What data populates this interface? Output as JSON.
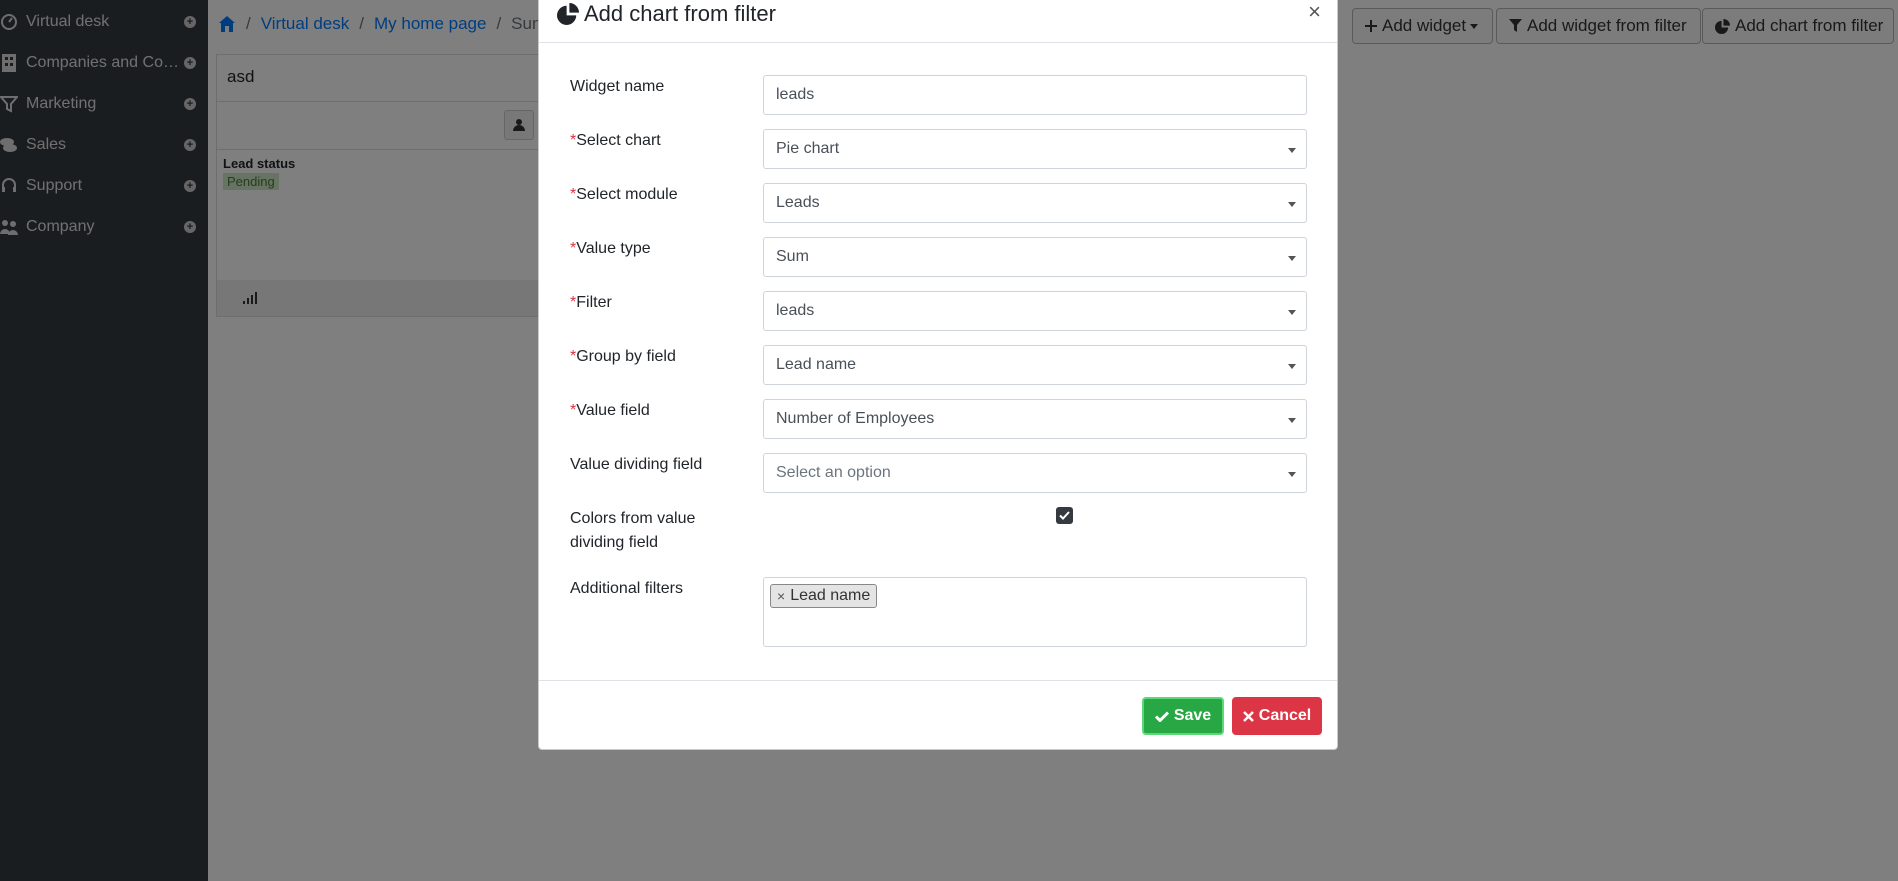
{
  "sidebar": {
    "items": [
      {
        "label": "Virtual desk",
        "icon": "speedometer-icon"
      },
      {
        "label": "Companies and Con...",
        "icon": "building-icon"
      },
      {
        "label": "Marketing",
        "icon": "funnel-icon"
      },
      {
        "label": "Sales",
        "icon": "coins-icon"
      },
      {
        "label": "Support",
        "icon": "headset-icon"
      },
      {
        "label": "Company",
        "icon": "users-icon"
      }
    ]
  },
  "breadcrumb": {
    "home_icon": "home-icon",
    "items": [
      "Virtual desk",
      "My home page",
      "Summa"
    ]
  },
  "toolbar": {
    "add_widget": "Add widget",
    "add_widget_from_filter": "Add widget from filter",
    "add_chart_from_filter": "Add chart from filter"
  },
  "widget": {
    "title": "asd",
    "field_label": "Lead status",
    "status_badge": "Pending"
  },
  "modal": {
    "title": "Add chart from filter",
    "close": "×",
    "fields": {
      "widget_name": {
        "label": "Widget name",
        "value": "leads"
      },
      "select_chart": {
        "required": "*",
        "label": "Select chart",
        "value": "Pie chart"
      },
      "select_module": {
        "required": "*",
        "label": "Select module",
        "value": "Leads"
      },
      "value_type": {
        "required": "*",
        "label": "Value type",
        "value": "Sum"
      },
      "filter": {
        "required": "*",
        "label": "Filter",
        "value": "leads"
      },
      "group_by": {
        "required": "*",
        "label": "Group by field",
        "value": "Lead name"
      },
      "value_field": {
        "required": "*",
        "label": "Value field",
        "value": "Number of Employees"
      },
      "value_dividing": {
        "label": "Value dividing field",
        "placeholder": "Select an option"
      },
      "colors_from_dividing": {
        "label_line1": "Colors from value",
        "label_line2": "dividing field",
        "checked": true
      },
      "additional_filters": {
        "label": "Additional filters",
        "tags": [
          "Lead name"
        ]
      }
    },
    "save_label": "Save",
    "cancel_label": "Cancel"
  },
  "colors": {
    "sidebar_bg": "#343a40",
    "link": "#007bff",
    "required": "#dc3545",
    "save": "#28a745",
    "cancel": "#dc3545"
  }
}
